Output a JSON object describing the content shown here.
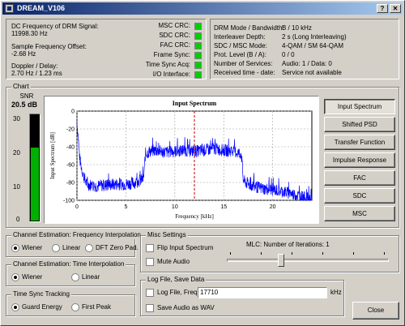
{
  "window": {
    "title": "DREAM_V106"
  },
  "status": {
    "dc_freq_label": "DC Frequency of DRM Signal:",
    "dc_freq_value": "11998.30 Hz",
    "sample_offset_label": "Sample Frequency Offset:",
    "sample_offset_value": "-2.68 Hz",
    "doppler_label": "Doppler / Delay:",
    "doppler_value": "2.70 Hz / 1.23 ms",
    "indicators": [
      "MSC CRC:",
      "SDC CRC:",
      "FAC CRC:",
      "Frame Sync:",
      "Time Sync Acq:",
      "I/O Interface:"
    ],
    "indicator_color": "#00d000"
  },
  "info": {
    "labels": [
      "DRM Mode / Bandwidth:",
      "Interleaver Depth:",
      "SDC / MSC Mode:",
      "Prot. Level (B / A):",
      "Number of Services:",
      "Received time - date:"
    ],
    "values": [
      "B / 10 kHz",
      "2 s (Long Interleaving)",
      "4-QAM / SM 64-QAM",
      "0 / 0",
      "Audio: 1 / Data: 0",
      "Service not available"
    ]
  },
  "chart_section": {
    "title": "Chart",
    "snr_label": "SNR",
    "snr_value": "20.5 dB",
    "snr_ticks": [
      "30",
      "20",
      "10",
      "0"
    ],
    "snr_level": 0.68
  },
  "chart_data": {
    "type": "line",
    "title": "Input Spectrum",
    "xlabel": "Frequency [kHz]",
    "ylabel": "Input Spectrum [dB]",
    "xlim": [
      0,
      24
    ],
    "ylim": [
      -100,
      0
    ],
    "x_ticks": [
      "0",
      "5",
      "10",
      "15",
      "20"
    ],
    "y_ticks": [
      "0",
      "-20",
      "-40",
      "-60",
      "-80",
      "-100"
    ],
    "marker_x": 12,
    "line_color": "#0000ff",
    "marker_color": "#c00000",
    "grid": true,
    "series": [
      {
        "x": [
          0,
          0.3,
          0.6,
          1.0,
          2,
          3,
          4,
          5,
          6,
          6.8,
          7.0,
          7.5,
          8,
          9,
          10,
          11,
          12,
          13,
          14,
          15,
          16,
          16.8,
          17.0,
          17.5,
          18,
          19,
          20,
          21,
          22,
          23,
          23.5,
          24
        ],
        "y": [
          -10,
          -55,
          -70,
          -82,
          -84,
          -83,
          -82,
          -82,
          -80,
          -76,
          -48,
          -45,
          -44,
          -46,
          -45,
          -44,
          -45,
          -44,
          -42,
          -44,
          -45,
          -48,
          -78,
          -82,
          -84,
          -87,
          -88,
          -90,
          -93,
          -96,
          -98,
          -100
        ]
      }
    ]
  },
  "chart_buttons": [
    "Input Spectrum",
    "Shifted PSD",
    "Transfer Function",
    "Impulse Response",
    "FAC",
    "SDC",
    "MSC"
  ],
  "freq_interp": {
    "title": "Channel Estimation: Frequency Interpolation",
    "options": [
      "Wiener",
      "Linear",
      "DFT Zero Pad."
    ]
  },
  "time_interp": {
    "title": "Channel Estimation: Time Interpolation",
    "options": [
      "Wiener",
      "Linear"
    ]
  },
  "time_sync": {
    "title": "Time Sync Tracking",
    "options": [
      "Guard Energy",
      "First Peak"
    ]
  },
  "misc": {
    "title": "Misc Settings",
    "flip_label": "Flip Input Spectrum",
    "mute_label": "Mute Audio",
    "mlc_label": "MLC: Number of Iterations: 1",
    "mlc_value": 0.33
  },
  "logfile": {
    "title": "Log File, Save Data",
    "log_label": "Log File, Freq:",
    "freq_value": "17710",
    "khz_label": "kHz",
    "save_wav_label": "Save Audio as WAV"
  },
  "close_label": "Close"
}
